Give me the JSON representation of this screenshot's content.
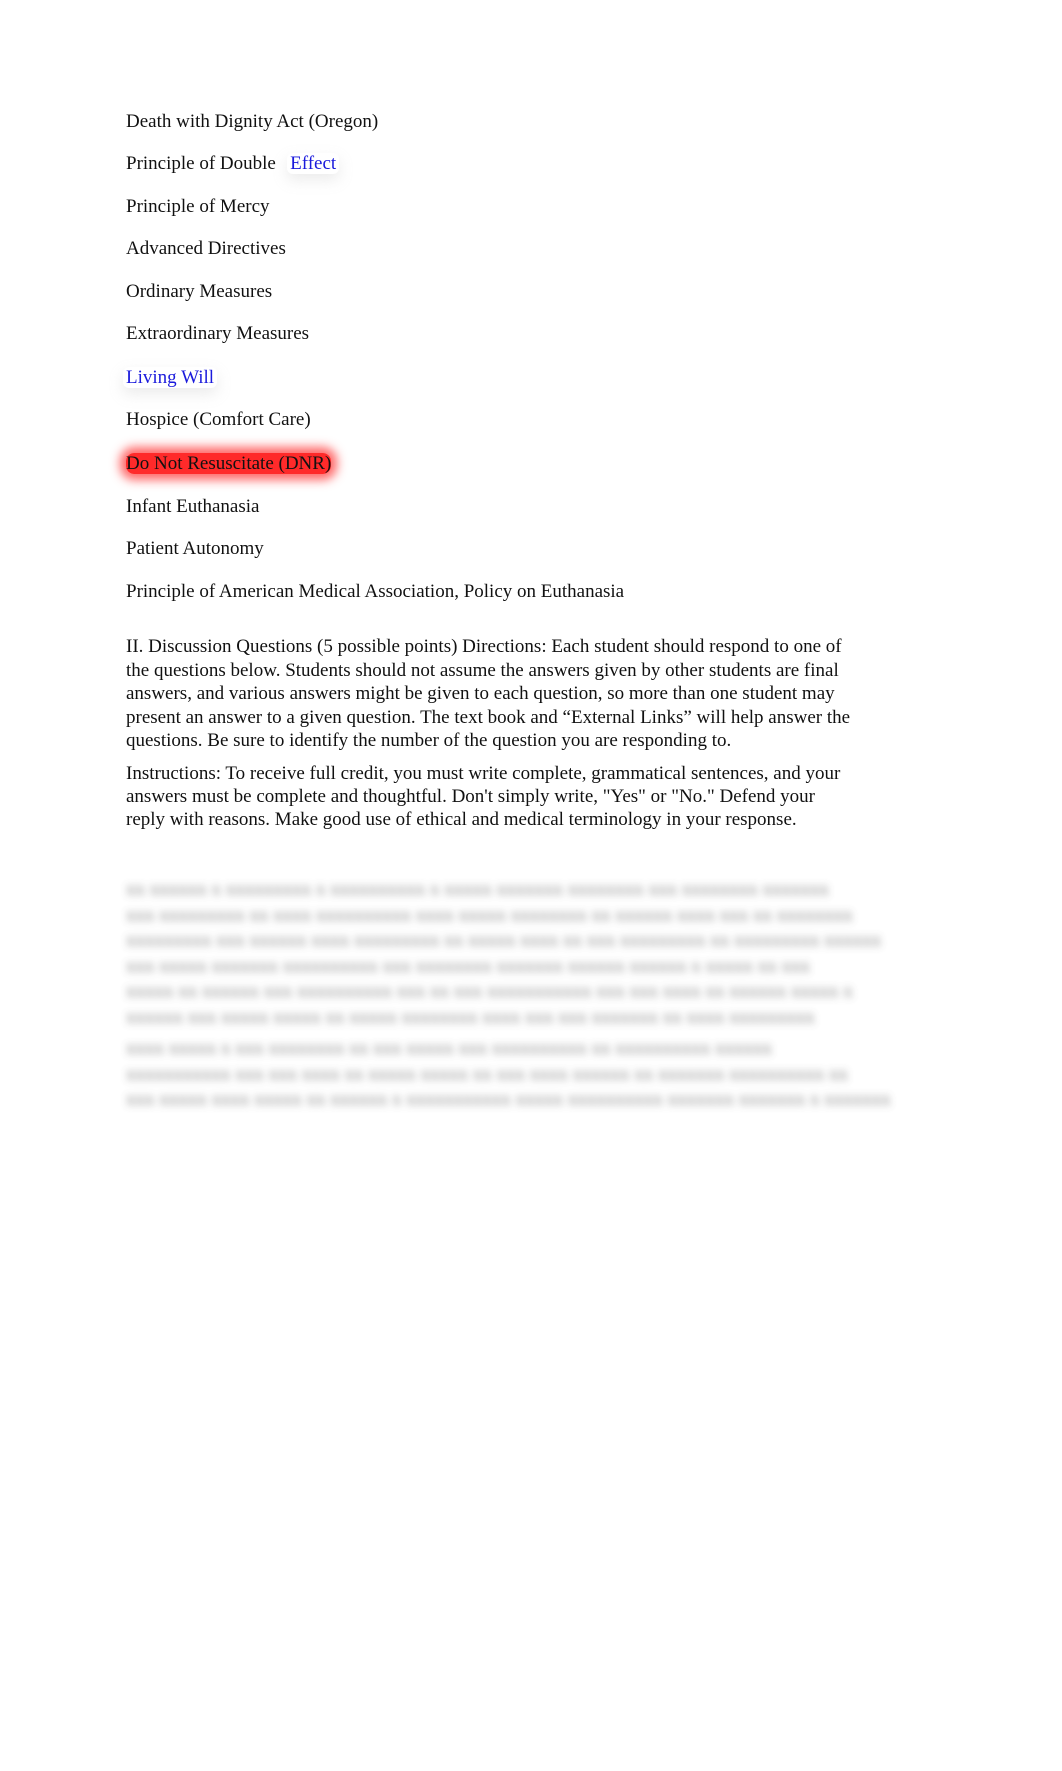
{
  "terms": [
    {
      "label": "Death with Dignity Act (Oregon)"
    },
    {
      "label_a": "Principle of Double",
      "label_b": "Effect"
    },
    {
      "label": "Principle of Mercy"
    },
    {
      "label": "Advanced Directives"
    },
    {
      "label": "Ordinary Measures"
    },
    {
      "label": "Extraordinary Measures"
    },
    {
      "label": "Living Will"
    },
    {
      "label": "Hospice (Comfort Care)"
    },
    {
      "label": "Do Not Resuscitate (DNR)"
    },
    {
      "label": "Infant Euthanasia"
    },
    {
      "label": "Patient Autonomy"
    },
    {
      "label": "Principle of American Medical Association, Policy on Euthanasia"
    }
  ],
  "colors": {
    "link": "#1a1adc",
    "highlight": "#ff2a2a"
  },
  "discussion": {
    "lines": [
      "II. Discussion Questions (5 possible points) Directions: Each student should respond to one of",
      "the questions below. Students should not assume the answers given by other students are final",
      "answers, and various answers might be given to each question, so more than one student may",
      "present an answer to a given question.  The text book and “External Links” will help answer the",
      "questions. Be sure to identify the number of the question you are responding to."
    ]
  },
  "instructions": {
    "lines": [
      "Instructions: To receive full credit, you must write complete, grammatical sentences, and your",
      "answers must be complete and thoughtful.  Don't simply write, \"Yes\" or \"No.\"  Defend your",
      "reply with reasons.  Make good use of ethical and medical terminology in your response."
    ]
  },
  "blurred_section": {
    "note": "obscured content",
    "lines": [
      "   xx xxxxxx x xxxxxxxxx x xxxxxxxxxx x xxxxx xxxxxxx xxxxxxxx xxx xxxxxxxx xxxxxxx",
      "xxx xxxxxxxxx xx xxxx xxxxxxxxxx      xxxx xxxxx xxxxxxxx xx xxxxxx xxxx xxx xx xxxxxxxx",
      "xxxxxxxxx  xxx xxxxxx xxxx xxxxxxxxx xx xxxxx  xxxx xx xxx xxxxxxxxx xx xxxxxxxxx xxxxxx",
      "xxx xxxxx  xxxxxxx xxxxxxxxxx xxx    xxxxxxxx xxxxxxx xxxxxx  xxxxxx x xxxxx xx xxx",
      "xxxxx xx xxxxxx xxx xxxxxxxxxx xxx xx xxx xxxxxxxxxxx xxx xxx xxxx xx xxxxxx xxxxx x",
      "xxxxxx xxx xxxxx xxxxx xx xxxxx xxxxxxxx xxxx xxx xxx xxxxxxx xx xxxx xxxxxxxxx",
      "   xxxx xxxxx x xxx xxxxxxxx xx xxx xxxxx  xxx xxxxxxxxxx xx xxxxxxxxxx  xxxxxx",
      "xxxxxxxxxxx  xxx xxx xxxx xx xxxxx xxxxx xx xxx xxxx xxxxxx xx  xxxxxxx xxxxxxxxxx   xx",
      "xxx xxxxx xxxx xxxxx xx xxxxxx x xxxxxxxxxxx xxxxx xxxxxxxxxx xxxxxxx xxxxxxx x xxxxxxx"
    ]
  }
}
